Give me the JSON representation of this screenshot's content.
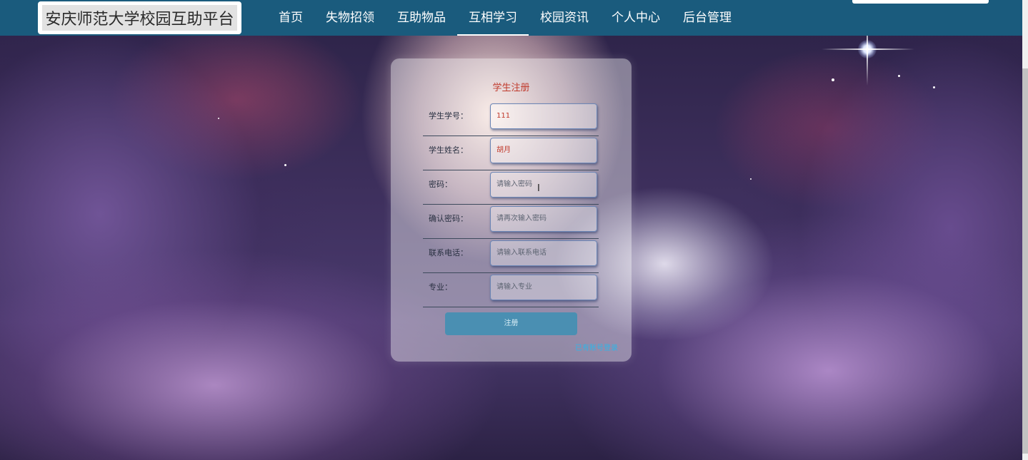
{
  "header": {
    "site_title": "安庆师范大学校园互助平台",
    "nav": [
      {
        "label": "首页",
        "active": false
      },
      {
        "label": "失物招领",
        "active": false
      },
      {
        "label": "互助物品",
        "active": false
      },
      {
        "label": "互相学习",
        "active": true
      },
      {
        "label": "校园资讯",
        "active": false
      },
      {
        "label": "个人中心",
        "active": false
      },
      {
        "label": "后台管理",
        "active": false
      }
    ]
  },
  "form": {
    "title": "学生注册",
    "fields": [
      {
        "label": "学生学号：",
        "value": "111",
        "placeholder": ""
      },
      {
        "label": "学生姓名：",
        "value": "胡月",
        "placeholder": ""
      },
      {
        "label": "密码：",
        "value": "",
        "placeholder": "请输入密码"
      },
      {
        "label": "确认密码：",
        "value": "",
        "placeholder": "请再次输入密码"
      },
      {
        "label": "联系电话：",
        "value": "",
        "placeholder": "请输入联系电话"
      },
      {
        "label": "专业：",
        "value": "",
        "placeholder": "请输入专业"
      }
    ],
    "submit_label": "注册",
    "login_link": "已有账号登录"
  },
  "colors": {
    "navbar": "#1a5b7d",
    "title_red": "#c0392b",
    "button": "#4a8fb2",
    "link": "#2fb5e8"
  }
}
